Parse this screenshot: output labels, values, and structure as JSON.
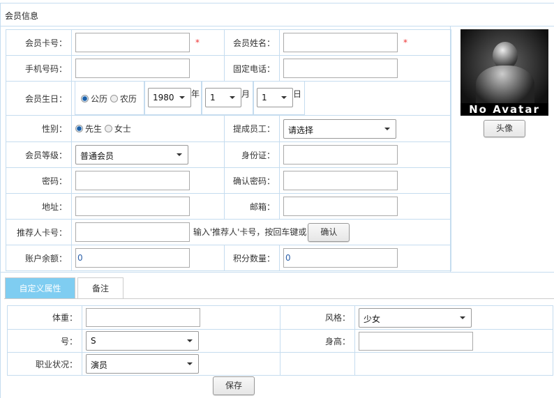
{
  "header": {
    "title": "会员信息"
  },
  "form": {
    "card_no": {
      "label": "会员卡号：",
      "value": "",
      "required": "*"
    },
    "name": {
      "label": "会员姓名：",
      "value": "",
      "required": "*"
    },
    "mobile": {
      "label": "手机号码：",
      "value": ""
    },
    "phone": {
      "label": "固定电话：",
      "value": ""
    },
    "birthday": {
      "label": "会员生日：",
      "calendar_solar": "公历",
      "calendar_lunar": "农历",
      "year": "1980",
      "year_unit": "年",
      "month": "1",
      "month_unit": "月",
      "day": "1",
      "day_unit": "日"
    },
    "gender": {
      "label": "性别：",
      "male": "先生",
      "female": "女士"
    },
    "staff": {
      "label": "提成员工：",
      "value": "请选择"
    },
    "level": {
      "label": "会员等级：",
      "value": "普通会员"
    },
    "id_card": {
      "label": "身份证：",
      "value": ""
    },
    "password": {
      "label": "密码：",
      "value": ""
    },
    "confirm_password": {
      "label": "确认密码：",
      "value": ""
    },
    "address": {
      "label": "地址：",
      "value": ""
    },
    "email": {
      "label": "邮箱：",
      "value": ""
    },
    "referrer": {
      "label": "推荐人卡号：",
      "value": "",
      "hint": "输入'推荐人'卡号，按回车键或",
      "confirm": "确认"
    },
    "balance": {
      "label": "账户余额：",
      "value": "0"
    },
    "points": {
      "label": "积分数量：",
      "value": "0"
    }
  },
  "avatar": {
    "caption": "No Avatar",
    "button": "头像"
  },
  "tabs": [
    {
      "label": "自定义属性",
      "active": true
    },
    {
      "label": "备注",
      "active": false
    }
  ],
  "custom": {
    "weight": {
      "label": "体重：",
      "value": ""
    },
    "style": {
      "label": "风格：",
      "value": "少女"
    },
    "size": {
      "label": "号：",
      "value": "S"
    },
    "height": {
      "label": "身高：",
      "value": ""
    },
    "job": {
      "label": "职业状况：",
      "value": "演员"
    }
  },
  "save": "保存",
  "colors": {
    "tab_active": "#7fcdf1",
    "border": "#c5dcef",
    "required": "#e33333"
  }
}
